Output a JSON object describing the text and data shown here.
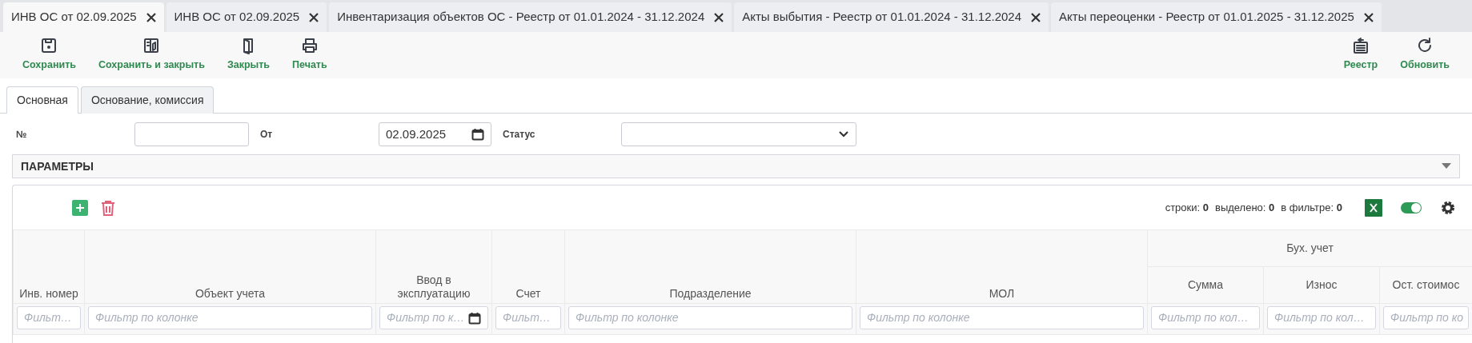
{
  "tabs": [
    {
      "label": "ИНВ ОС от 02.09.2025",
      "selected": true
    },
    {
      "label": "ИНВ ОС от 02.09.2025",
      "selected": false
    },
    {
      "label": "Инвентаризация объектов ОС - Реестр от 01.01.2024 - 31.12.2024",
      "selected": false
    },
    {
      "label": "Акты выбытия - Реестр от 01.01.2024 - 31.12.2024",
      "selected": false
    },
    {
      "label": "Акты переоценки - Реестр от 01.01.2025 - 31.12.2025",
      "selected": false
    }
  ],
  "toolbar_left": [
    {
      "kind": "save",
      "label": "Сохранить"
    },
    {
      "kind": "save_close",
      "label": "Сохранить и закрыть"
    },
    {
      "kind": "close",
      "label": "Закрыть"
    },
    {
      "kind": "print",
      "label": "Печать"
    }
  ],
  "toolbar_right": [
    {
      "kind": "registry",
      "label": "Реестр"
    },
    {
      "kind": "refresh",
      "label": "Обновить"
    }
  ],
  "form_tabs": [
    {
      "label": "Основная",
      "selected": true
    },
    {
      "label": "Основание, комиссия",
      "selected": false
    }
  ],
  "fields": [
    {
      "kind": "text",
      "label": "№"
    },
    {
      "kind": "date",
      "label": "От",
      "value": "02.09.2025"
    },
    {
      "kind": "select",
      "label": "Статус"
    }
  ],
  "section": {
    "title": "ПАРАМЕТРЫ",
    "expanded": true
  },
  "grid": {
    "stats": [
      "строки: **0**",
      "выделено: **0**",
      "в фильтре: **0**"
    ],
    "toggle_on": true,
    "columns": [
      {
        "kind": "text",
        "label": "Инв. номер",
        "placeholder": "Фильт…"
      },
      {
        "kind": "text",
        "label": "Объект учета",
        "placeholder": "Фильтр по колонке"
      },
      {
        "kind": "date",
        "label": "Ввод в эксплуатацию",
        "placeholder": "Фильтр по к…"
      },
      {
        "kind": "text",
        "label": "Счет",
        "placeholder": "Фильт…"
      },
      {
        "kind": "text",
        "label": "Подразделение",
        "placeholder": "Фильтр по колонке"
      },
      {
        "kind": "text",
        "label": "МОЛ",
        "placeholder": "Фильтр по колонке"
      },
      {
        "kind": "group",
        "label": "Бух. учет",
        "children": [
          {
            "label": "Сумма",
            "placeholder": "Фильтр по кол…"
          },
          {
            "label": "Износ",
            "placeholder": "Фильтр по кол…"
          },
          {
            "label": "Ост. стоимос",
            "placeholder": "Фильтр по ко"
          }
        ]
      }
    ]
  }
}
